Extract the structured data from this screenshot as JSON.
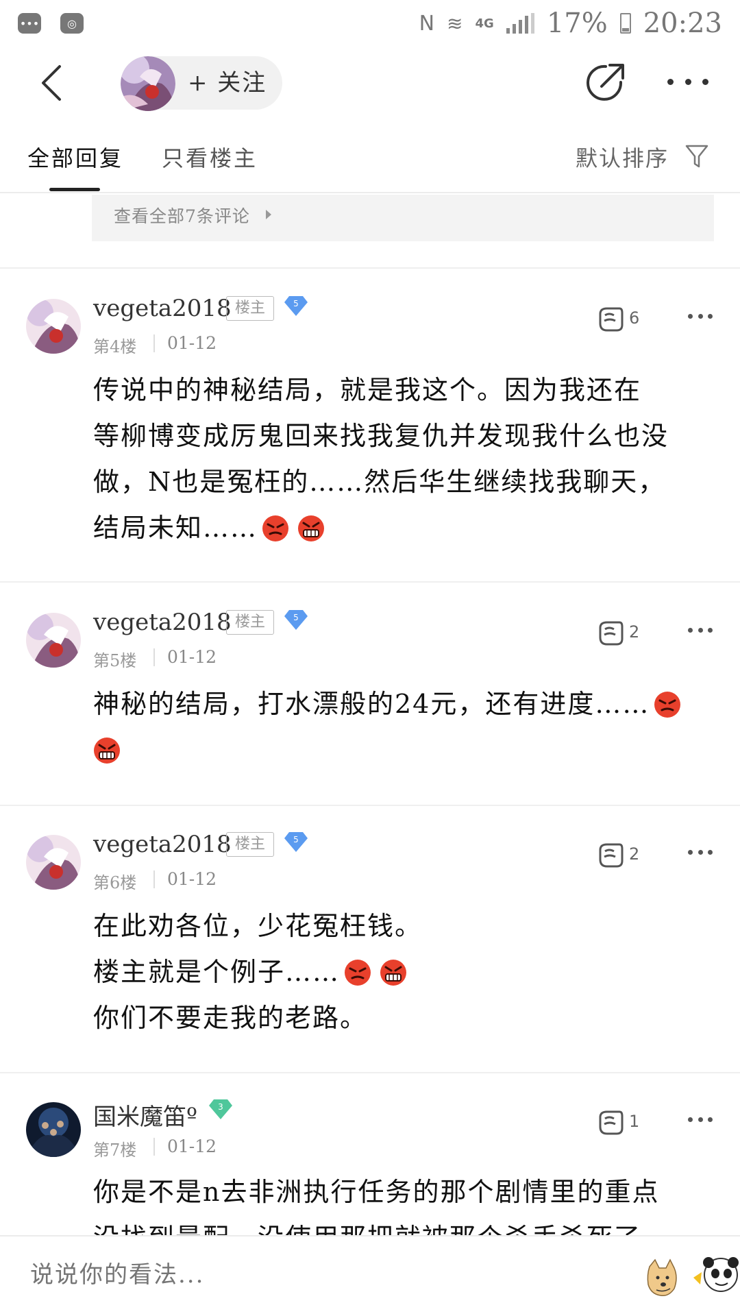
{
  "status_bar": {
    "network": "4G",
    "battery": "17%",
    "time": "20:23"
  },
  "header": {
    "follow_label": "+ 关注"
  },
  "tabs": {
    "all_replies": "全部回复",
    "owner_only": "只看楼主",
    "sort": "默认排序"
  },
  "comment_box": {
    "view_all": "查看全部7条评论"
  },
  "posts": [
    {
      "username": "vegeta2018",
      "badge": "楼主",
      "level": "5",
      "floor": "第4楼",
      "date": "01-12",
      "likes": "6",
      "lines": [
        "传说中的神秘结局，就是我这个。因为我还在",
        "等柳博变成厉鬼回来找我复仇并发现我什么也没",
        "做，N也是冤枉的……然后华生继续找我聊天，",
        "结局未知……"
      ]
    },
    {
      "username": "vegeta2018",
      "badge": "楼主",
      "level": "5",
      "floor": "第5楼",
      "date": "01-12",
      "likes": "2",
      "lines": [
        "神秘的结局，打水漂般的24元，还有进度……"
      ]
    },
    {
      "username": "vegeta2018",
      "badge": "楼主",
      "level": "5",
      "floor": "第6楼",
      "date": "01-12",
      "likes": "2",
      "lines": [
        "在此劝各位，少花冤枉钱。",
        "楼主就是个例子……",
        "你们不要走我的老路。"
      ]
    },
    {
      "username": "国米魔笛º",
      "level": "3",
      "floor": "第7楼",
      "date": "01-12",
      "likes": "1",
      "lines": [
        "你是不是n去非洲执行任务的那个剧情里的重点",
        "没找到最配，没使用那把就被那个杀手杀死了"
      ]
    }
  ],
  "bottom_bar": {
    "placeholder": "说说你的看法..."
  },
  "colors": {
    "level5": "#5b9bf0",
    "level3": "#4fc79b",
    "emoji": "#e8402c"
  },
  "icons": [
    "back-icon",
    "share-icon",
    "more-icon",
    "filter-icon",
    "like-icon",
    "diamond-icon",
    "angry-emoji-icon",
    "grin-emoji-icon"
  ]
}
